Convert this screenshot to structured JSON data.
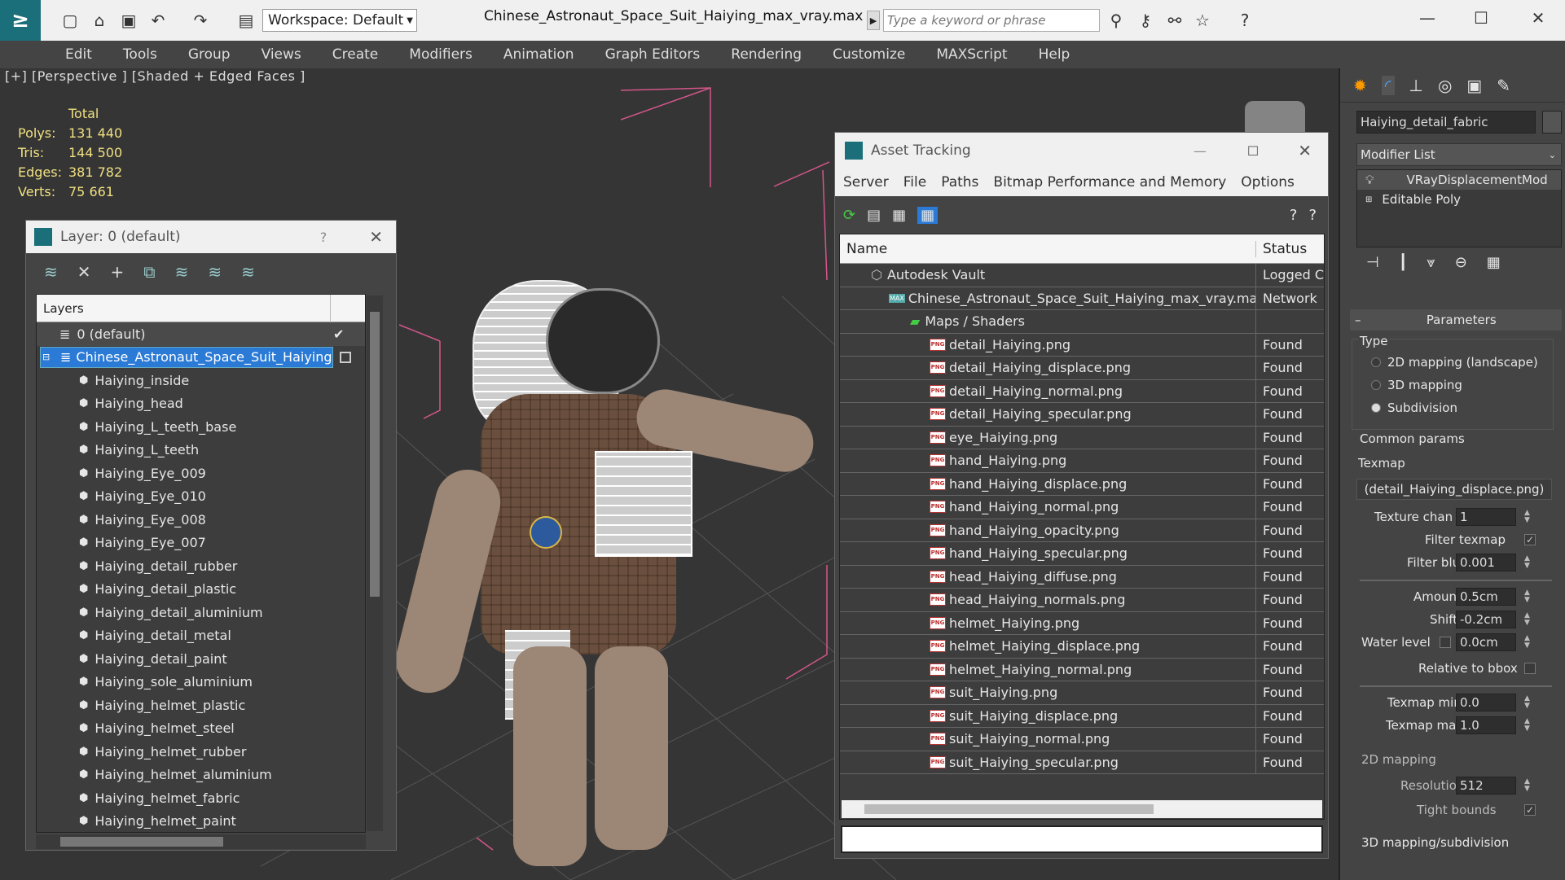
{
  "app": {
    "title": "Chinese_Astronaut_Space_Suit_Haiying_max_vray.max",
    "workspace": "Workspace: Default",
    "search_placeholder": "Type a keyword or phrase"
  },
  "menu": [
    "Edit",
    "Tools",
    "Group",
    "Views",
    "Create",
    "Modifiers",
    "Animation",
    "Graph Editors",
    "Rendering",
    "Customize",
    "MAXScript",
    "Help"
  ],
  "viewport": {
    "label": "[+] [Perspective ] [Shaded + Edged Faces ]",
    "stats": {
      "header": "Total",
      "rows": [
        {
          "label": "Polys:",
          "value": "131 440"
        },
        {
          "label": "Tris:",
          "value": "144 500"
        },
        {
          "label": "Edges:",
          "value": "381 782"
        },
        {
          "label": "Verts:",
          "value": "75 661"
        }
      ]
    }
  },
  "layer_window": {
    "title": "Layer: 0 (default)",
    "help": "?",
    "column": "Layers",
    "default_layer": "0 (default)",
    "root_layer": "Chinese_Astronaut_Space_Suit_Haiying",
    "items": [
      "Haiying_inside",
      "Haiying_head",
      "Haiying_L_teeth_base",
      "Haiying_L_teeth",
      "Haiying_Eye_009",
      "Haiying_Eye_010",
      "Haiying_Eye_008",
      "Haiying_Eye_007",
      "Haiying_detail_rubber",
      "Haiying_detail_plastic",
      "Haiying_detail_aluminium",
      "Haiying_detail_metal",
      "Haiying_detail_paint",
      "Haiying_sole_aluminium",
      "Haiying_helmet_plastic",
      "Haiying_helmet_steel",
      "Haiying_helmet_rubber",
      "Haiying_helmet_aluminium",
      "Haiying_helmet_fabric",
      "Haiying_helmet_paint"
    ]
  },
  "asset_window": {
    "title": "Asset Tracking",
    "menu": [
      "Server",
      "File",
      "Paths",
      "Bitmap Performance and Memory",
      "Options"
    ],
    "columns": {
      "name": "Name",
      "status": "Status"
    },
    "vault": {
      "name": "Autodesk Vault",
      "status": "Logged C"
    },
    "file": {
      "name": "Chinese_Astronaut_Space_Suit_Haiying_max_vray.max",
      "status": "Network"
    },
    "folder": "Maps / Shaders",
    "png_badge": "PNG",
    "max_badge": "MAX",
    "maps": [
      "detail_Haiying.png",
      "detail_Haiying_displace.png",
      "detail_Haiying_normal.png",
      "detail_Haiying_specular.png",
      "eye_Haiying.png",
      "hand_Haiying.png",
      "hand_Haiying_displace.png",
      "hand_Haiying_normal.png",
      "hand_Haiying_opacity.png",
      "hand_Haiying_specular.png",
      "head_Haiying_diffuse.png",
      "head_Haiying_normals.png",
      "helmet_Haiying.png",
      "helmet_Haiying_displace.png",
      "helmet_Haiying_normal.png",
      "suit_Haiying.png",
      "suit_Haiying_displace.png",
      "suit_Haiying_normal.png",
      "suit_Haiying_specular.png"
    ],
    "found": "Found"
  },
  "cmd_panel": {
    "object_name": "Haiying_detail_fabric",
    "modifier_list": "Modifier List",
    "stack": [
      "VRayDisplacementMod",
      "Editable Poly"
    ],
    "rollout": "Parameters",
    "type_label": "Type",
    "types": [
      "2D mapping (landscape)",
      "3D mapping",
      "Subdivision"
    ],
    "common_params": "Common params",
    "texmap_label": "Texmap",
    "texmap_value": "(detail_Haiying_displace.png)",
    "texture_chan_label": "Texture chan",
    "texture_chan": "1",
    "filter_texmap": "Filter texmap",
    "filter_blur_label": "Filter blur",
    "filter_blur": "0.001",
    "amount_label": "Amount",
    "amount": "0.5cm",
    "shift_label": "Shift",
    "shift": "-0.2cm",
    "water_level_label": "Water level",
    "water_level": "0.0cm",
    "relative_bbox": "Relative to bbox",
    "texmap_min_label": "Texmap min",
    "texmap_min": "0.0",
    "texmap_max_label": "Texmap max",
    "texmap_max": "1.0",
    "mapping2d": "2D mapping",
    "resolution_label": "Resolution",
    "resolution": "512",
    "tight_bounds": "Tight bounds",
    "mapping3d": "3D mapping/subdivision"
  }
}
